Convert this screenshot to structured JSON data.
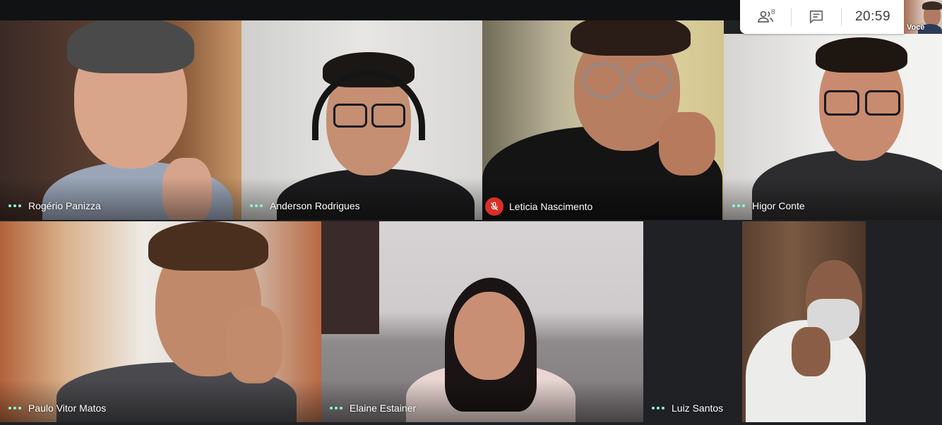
{
  "meeting": {
    "clock": "20:59",
    "participant_count": "8",
    "self_label": "Você"
  },
  "participants": [
    {
      "name": "Rogério Panizza",
      "muted": false
    },
    {
      "name": "Anderson Rodrigues",
      "muted": false
    },
    {
      "name": "Leticia Nascimento",
      "muted": true
    },
    {
      "name": "Higor Conte",
      "muted": false
    },
    {
      "name": "Paulo Vitor Matos",
      "muted": false
    },
    {
      "name": "Elaine Estainer",
      "muted": false
    },
    {
      "name": "Luiz Santos",
      "muted": false
    }
  ],
  "icons": {
    "people": "people-icon",
    "chat": "chat-icon",
    "speaking": "speaking-dots-icon",
    "mic_off": "mic-off-icon"
  },
  "colors": {
    "speaking_dots": "#8cf7d6",
    "mute_badge": "#d93025",
    "background": "#202124"
  }
}
